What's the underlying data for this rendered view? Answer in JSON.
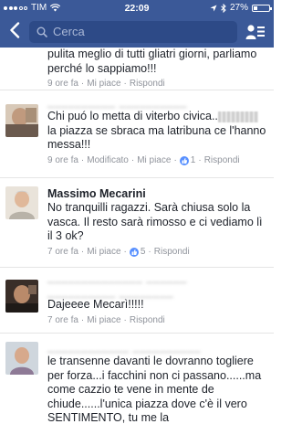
{
  "status_bar": {
    "carrier": "TIM",
    "time": "22:09",
    "battery": "27%",
    "battery_level": 0.27
  },
  "nav": {
    "search_placeholder": "Cerca"
  },
  "comments": [
    {
      "text": "pulita meglio di tutti gliatri giorni, parliamo perché lo sappiamo!!!",
      "time": "9 ore fa",
      "like": "Mi piace",
      "reply": "Rispondi"
    },
    {
      "author": "",
      "text_before": "Chi puó lo metta di viterbo civica..",
      "text_after": " la piazza se sbraca ma latribuna ce l'hanno messa!!!",
      "time": "9 ore fa",
      "modified": "Modificato",
      "like": "Mi piace",
      "like_count": "1",
      "reply": "Rispondi"
    },
    {
      "author": "Massimo Mecarini",
      "text": "No tranquilli ragazzi. Sarà chiusa solo la vasca. Il resto sarà rimosso e ci vediamo lì il 3 ok?",
      "time": "7 ore fa",
      "like": "Mi piace",
      "like_count": "5",
      "reply": "Rispondi"
    },
    {
      "author": "",
      "text": "Dajeeee Mecarì!!!!!",
      "time": "7 ore fa",
      "like": "Mi piace",
      "reply": "Rispondi"
    },
    {
      "author": "",
      "text": "le transenne davanti le dovranno togliere per forza...i facchini non ci passano......ma come cazzio te vene in mente de chiude......l'unica piazza dove c'è il vero SENTIMENTO, tu me la"
    }
  ]
}
